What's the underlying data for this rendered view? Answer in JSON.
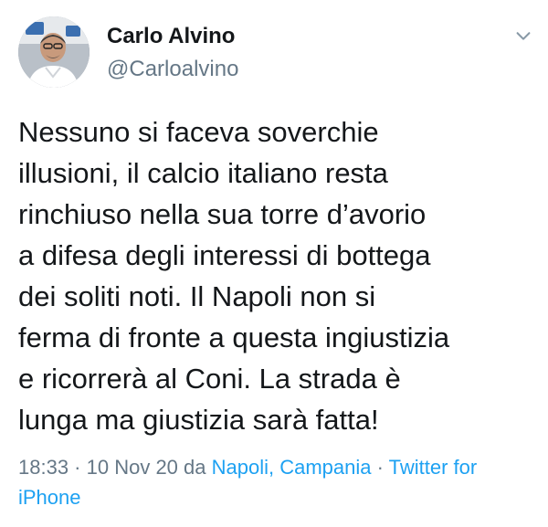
{
  "author": {
    "name": "Carlo Alvino",
    "handle": "@Carloalvino",
    "avatar_icon": "profile-photo"
  },
  "menu": {
    "icon": "chevron-down-icon"
  },
  "tweet": {
    "text": "Nessuno si faceva soverchie\nillusioni, il calcio italiano resta\nrinchiuso nella sua torre d’avorio\na difesa degli interessi di bottega\ndei soliti noti. Il Napoli non si\nferma di fronte a questa ingiustizia\ne ricorrerà al Coni. La strada è\nlunga ma giustizia sarà fatta!"
  },
  "meta": {
    "time": "18:33",
    "separator_1": " · ",
    "date": "10 Nov 20",
    "from_word": " da ",
    "location": "Napoli, Campania",
    "separator_2": " · ",
    "source": "Twitter for iPhone"
  },
  "colors": {
    "text": "#14171a",
    "secondary": "#657786",
    "link": "#1da1f2",
    "background": "#ffffff"
  }
}
